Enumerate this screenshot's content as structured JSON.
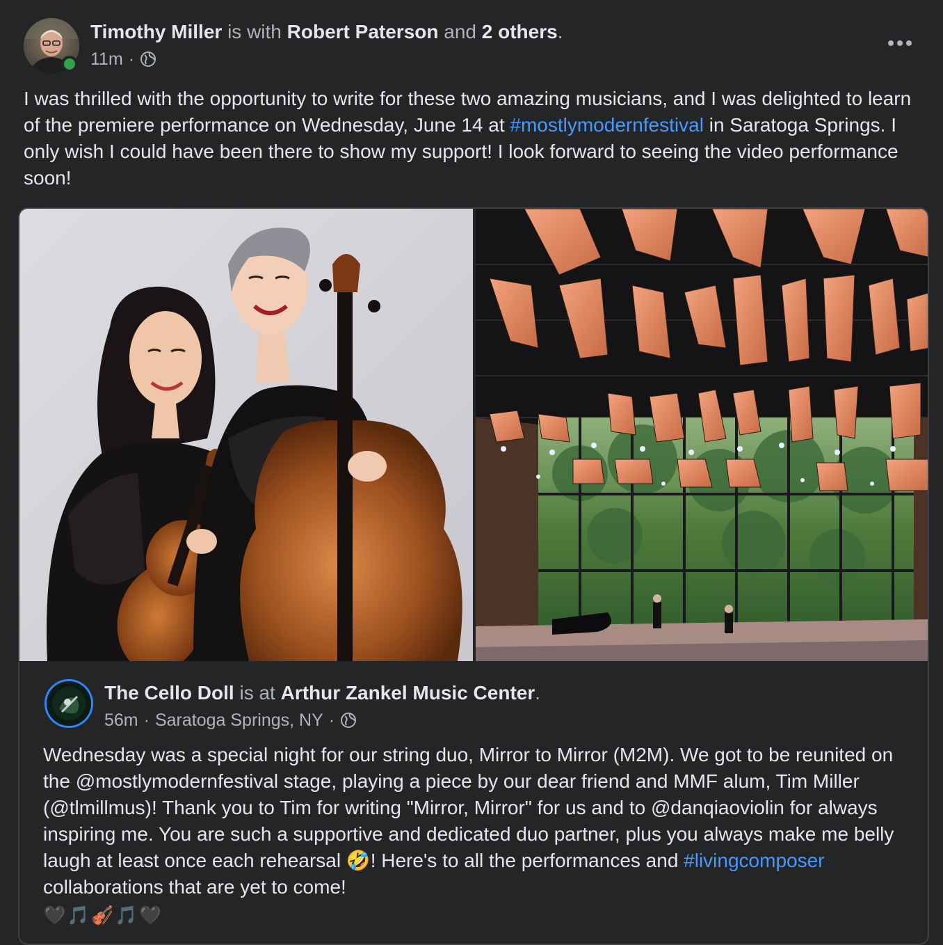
{
  "post": {
    "author": "Timothy Miller",
    "is_with": "is with",
    "tagged": "Robert Paterson",
    "and": "and",
    "others": "2 others",
    "period": ".",
    "time": "11m",
    "separator": "·",
    "text_part1": "I was thrilled with the opportunity to write for these two amazing musicians, and I was delighted to learn of the premiere performance on Wednesday, June 14 at ",
    "hashtag": "#mostlymodernfestival",
    "text_part2": " in Saratoga Springs. I only wish I could have been there to show my support! I look forward to seeing the video performance soon!",
    "audience_icon": "globe-icon",
    "more_icon": "more-options-icon",
    "online_color": "#31a24c"
  },
  "shared": {
    "author": "The Cello Doll",
    "is_at": "is at",
    "place": "Arthur Zankel Music Center",
    "period": ".",
    "time": "56m",
    "separator": "·",
    "location": "Saratoga Springs, NY",
    "separator2": "·",
    "text_part1": "Wednesday was a special night for our string duo, Mirror to Mirror (M2M). We got to be reunited on the @mostlymodernfestival stage, playing a piece by our dear friend and MMF alum, Tim Miller (@tlmillmus)! Thank you to Tim for writing \"Mirror, Mirror\" for us and to @danqiaoviolin for always inspiring me. You are such a supportive and dedicated duo partner, plus you always make me belly laugh at least once each rehearsal 🤣! Here's to all the performances and ",
    "hashtag": "#livingcomposer",
    "text_part2": " collaborations that are yet to come!",
    "emoji_line": "🖤🎵🎻🎵🖤"
  },
  "photos": {
    "left": "two-musicians-photo",
    "right": "concert-hall-photo"
  },
  "colors": {
    "background": "#242526",
    "text": "#e4e6eb",
    "secondary": "#b0b3b8",
    "link": "#4599ff",
    "ring": "#2d88ff"
  }
}
